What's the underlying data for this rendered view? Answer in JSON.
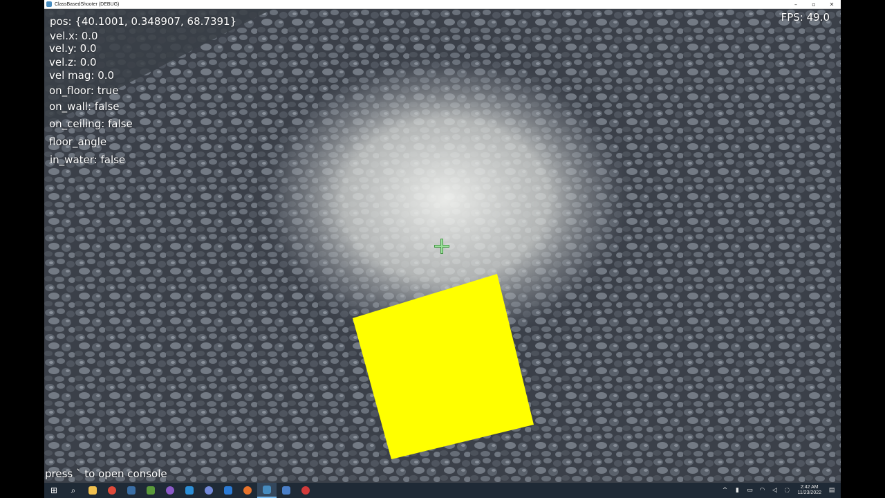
{
  "window": {
    "title": "ClassBasedShooter (DEBUG)",
    "minimize_glyph": "–",
    "maximize_glyph": "▫",
    "close_glyph": "✕"
  },
  "hud": {
    "pos": "pos: {40.1001, 0.348907, 68.7391}",
    "vel_x": "vel.x: 0.0",
    "vel_y": "vel.y: 0.0",
    "vel_z": "vel.z: 0.0",
    "vel_mag": "vel mag: 0.0",
    "on_floor": "on_floor: true",
    "on_wall": "on_wall: false",
    "on_ceiling": "on_ceiling: false",
    "floor_angle": "floor_angle",
    "in_water": "in_water: false",
    "fps": "FPS: 49.0",
    "console_hint": "press ` to open console"
  },
  "colors": {
    "box": "#ffff00",
    "crosshair": "#2e8b2e",
    "ground_dark": "#3d4450",
    "spot_light": "#e9ebe8"
  },
  "taskbar": {
    "icons": [
      {
        "name": "windows-start-icon",
        "glyph": "⊞",
        "color": "#ffffff"
      },
      {
        "name": "search-icon",
        "glyph": "⌕",
        "color": "#ffffff"
      },
      {
        "name": "file-explorer-icon",
        "glyph": "",
        "color": "#f2c14e"
      },
      {
        "name": "chrome-icon",
        "glyph": "",
        "color": "#e04a3a"
      },
      {
        "name": "steam-icon",
        "glyph": "",
        "color": "#3a6ea5"
      },
      {
        "name": "minecraft-icon",
        "glyph": "",
        "color": "#5a9a3a"
      },
      {
        "name": "obs-icon",
        "glyph": "",
        "color": "#8a5ac8"
      },
      {
        "name": "vscode-icon",
        "glyph": "",
        "color": "#2c8fd8"
      },
      {
        "name": "discord-icon",
        "glyph": "",
        "color": "#7289da"
      },
      {
        "name": "blue-app-icon",
        "glyph": "",
        "color": "#2b7bd6"
      },
      {
        "name": "firefox-icon",
        "glyph": "",
        "color": "#e8732b"
      },
      {
        "name": "godot-icon",
        "glyph": "",
        "color": "#478cbf",
        "active": true
      },
      {
        "name": "app-a-icon",
        "glyph": "",
        "color": "#4a7fc8"
      },
      {
        "name": "red-app-icon",
        "glyph": "",
        "color": "#d23a3a"
      }
    ],
    "tray": {
      "chevron": "^",
      "time": "2:42 AM",
      "date": "11/23/2022"
    }
  }
}
